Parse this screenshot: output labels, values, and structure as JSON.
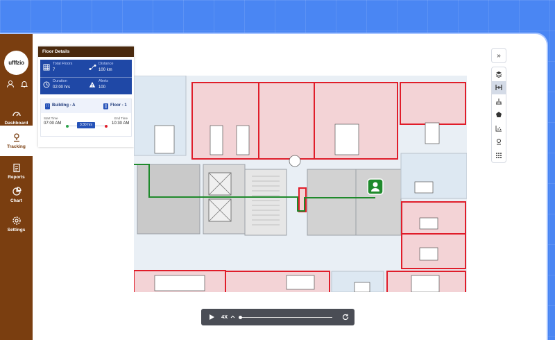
{
  "brand": {
    "logo_text": "ufffzio"
  },
  "sidebar": {
    "items": [
      {
        "label": "Dashboard",
        "icon": "dashboard-icon",
        "active": false
      },
      {
        "label": "Tracking",
        "icon": "tracking-icon",
        "active": true
      },
      {
        "label": "Reports",
        "icon": "reports-icon",
        "active": false
      },
      {
        "label": "Chart",
        "icon": "chart-icon",
        "active": false
      },
      {
        "label": "Settings",
        "icon": "settings-icon",
        "active": false
      }
    ]
  },
  "floor_details": {
    "title": "Floor Details",
    "stats": {
      "total_floors_label": "Total Floors",
      "total_floors_value": "7",
      "distance_label": "Distance",
      "distance_value": "100 km",
      "duration_label": "Duration",
      "duration_value": "02:00 hrs",
      "alerts_label": "Alerts",
      "alerts_value": "100"
    },
    "trip": {
      "building": "Building - A",
      "floor": "Floor - 1",
      "start_label": "Start Time",
      "start_value": "07:00 AM",
      "end_label": "End Time",
      "end_value": "10:30 AM",
      "duration_badge": "3:30 hrs"
    }
  },
  "toolbar": {
    "collapse_glyph": "»"
  },
  "player": {
    "speed": "4X"
  },
  "colors": {
    "sidebar": "#7a3e10",
    "panel_header": "#4a2a0e",
    "stats_bg": "#1f48a6",
    "zone_red": "#e01d2a",
    "route_green": "#1f8a2c"
  }
}
